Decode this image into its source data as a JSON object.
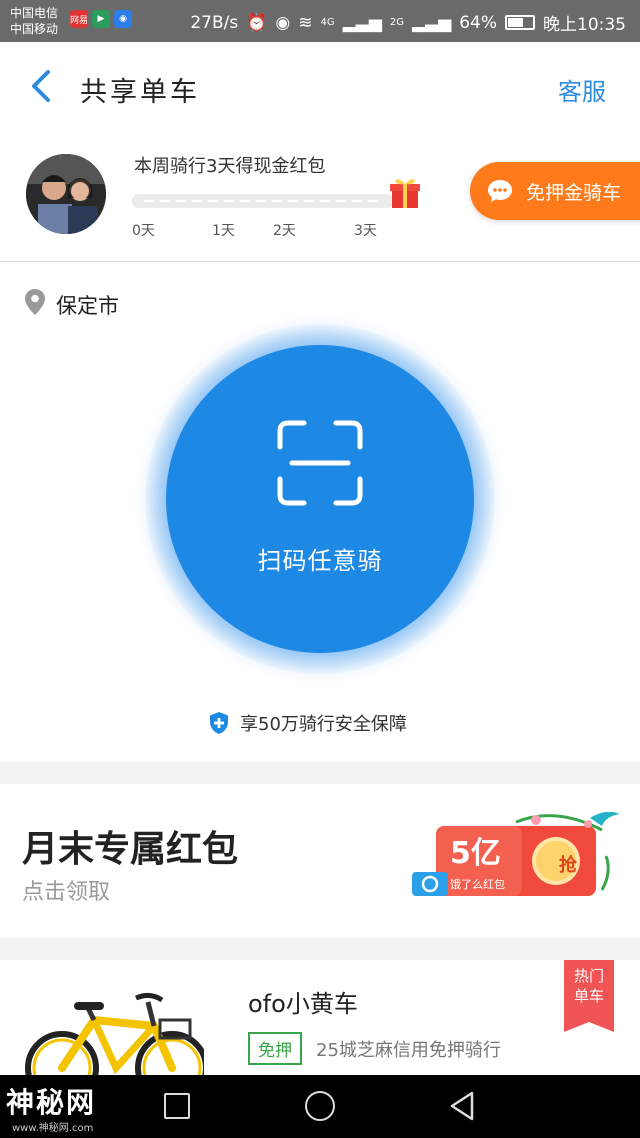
{
  "status_bar": {
    "carrier1": "中国电信",
    "carrier2": "中国移动",
    "app_badge1": "网易",
    "speed": "27B/s",
    "network1": "4G",
    "network2": "2G",
    "battery_percent": "64%",
    "battery_level": 0.64,
    "time": "晚上10:35"
  },
  "header": {
    "title": "共享单车",
    "service": "客服"
  },
  "progress": {
    "title": "本周骑行3天得现金红包",
    "ticks": [
      "0天",
      "1天",
      "2天",
      "3天"
    ],
    "days_ridden": 0,
    "deposit_free_button": "免押金骑车"
  },
  "location": {
    "city": "保定市"
  },
  "scan": {
    "label": "扫码任意骑"
  },
  "insurance": {
    "text": "享50万骑行安全保障"
  },
  "promo": {
    "title": "月末专属红包",
    "subtitle": "点击领取",
    "graphic_amount": "5亿",
    "graphic_brand": "饿了么红包",
    "graphic_button": "抢"
  },
  "bike": {
    "name": "ofo小黄车",
    "tag": "免押",
    "description": "25城芝麻信用免押骑行",
    "ribbon_line1": "热门",
    "ribbon_line2": "单车"
  },
  "watermark": {
    "text": "神秘网",
    "url": "www.神秘网.com"
  },
  "colors": {
    "primary": "#1e88e5",
    "accent": "#ff7a1a",
    "link": "#2d8ce0",
    "tag_green": "#3aa54a",
    "ribbon": "#f05454"
  }
}
